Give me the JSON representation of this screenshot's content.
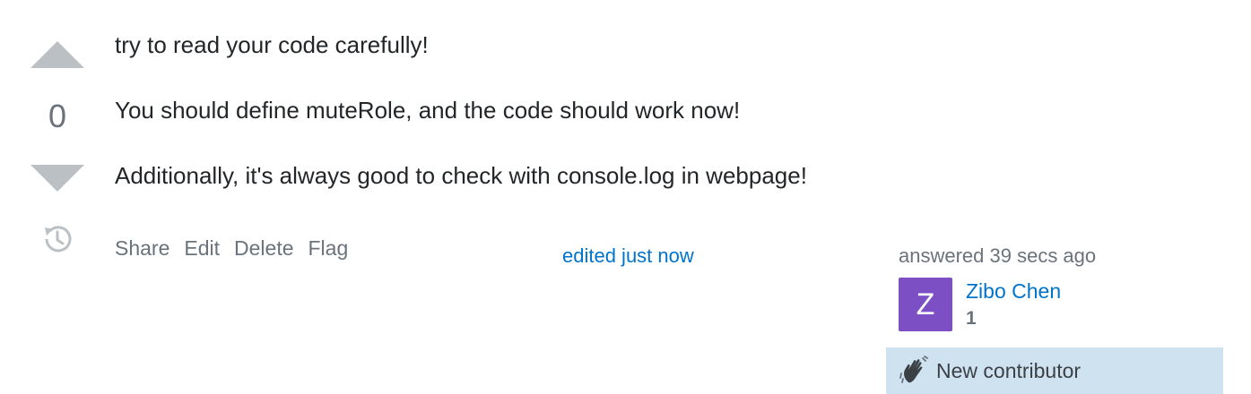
{
  "vote": {
    "count": "0",
    "up_icon": "arrow-up-icon",
    "down_icon": "arrow-down-icon",
    "history_icon": "history-icon"
  },
  "answer": {
    "paragraphs": [
      "try to read your code carefully!",
      "You should define muteRole, and the code should work now!",
      "Additionally, it's always good to check with console.log in webpage!"
    ]
  },
  "menu": {
    "share": "Share",
    "edit": "Edit",
    "delete": "Delete",
    "flag": "Flag"
  },
  "edited": "edited just now",
  "user_card": {
    "answered": "answered 39 secs ago",
    "avatar_letter": "Z",
    "avatar_color": "#7d4fc4",
    "name": "Zibo Chen",
    "reputation": "1",
    "new_contributor": "New contributor",
    "badge_icon": "waving-hand-icon"
  },
  "colors": {
    "link": "#0074cc",
    "muted": "#6a737c",
    "badge_bg": "#cfe2f0"
  }
}
